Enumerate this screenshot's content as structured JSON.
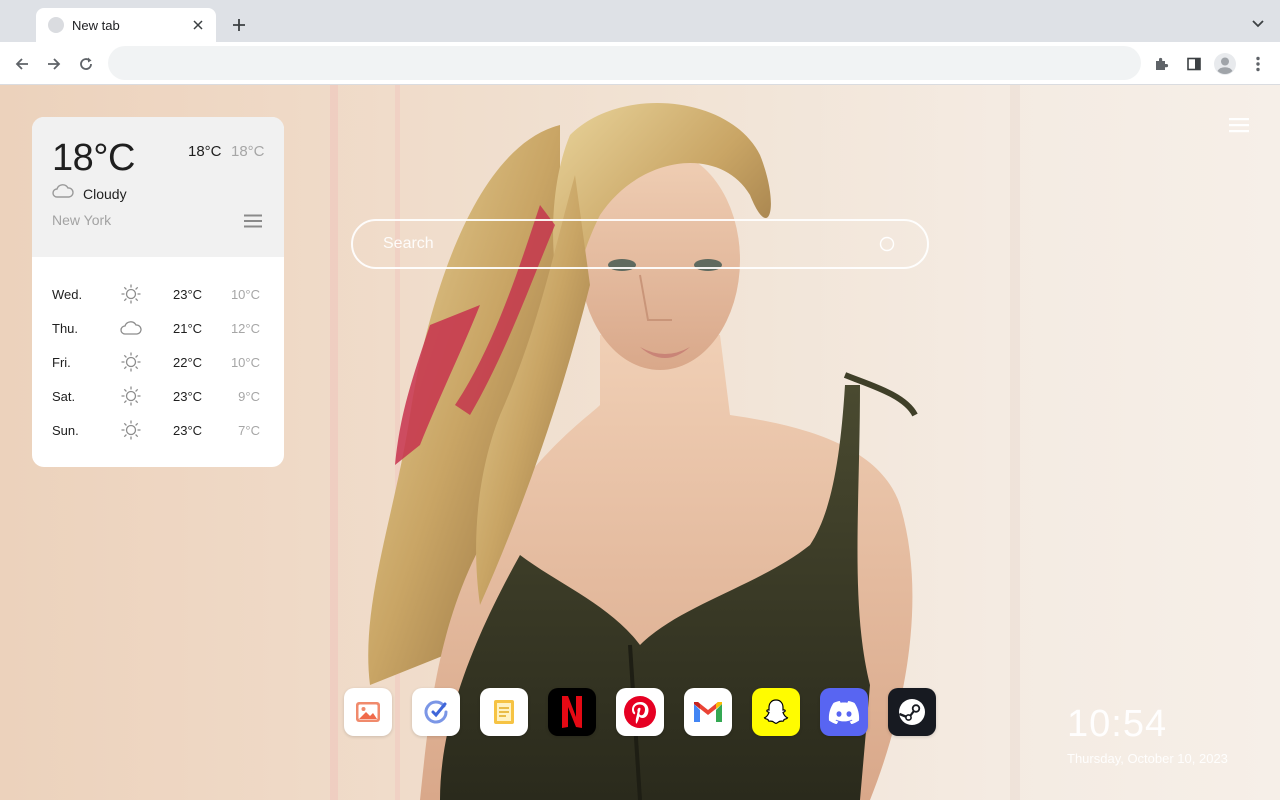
{
  "browser": {
    "tab": {
      "title": "New tab"
    },
    "omnibox": {
      "value": "",
      "placeholder": ""
    }
  },
  "weather": {
    "current_temp": "18°C",
    "high": "18°C",
    "low": "18°C",
    "condition": "Cloudy",
    "condition_icon": "cloud-icon",
    "city": "New York",
    "forecast": [
      {
        "day": "Wed.",
        "icon": "sun-icon",
        "high": "23°C",
        "low": "10°C"
      },
      {
        "day": "Thu.",
        "icon": "cloud-icon",
        "high": "21°C",
        "low": "12°C"
      },
      {
        "day": "Fri.",
        "icon": "sun-icon",
        "high": "22°C",
        "low": "10°C"
      },
      {
        "day": "Sat.",
        "icon": "sun-icon",
        "high": "23°C",
        "low": "9°C"
      },
      {
        "day": "Sun.",
        "icon": "sun-icon",
        "high": "23°C",
        "low": "7°C"
      }
    ]
  },
  "search": {
    "placeholder": "Search"
  },
  "dock": {
    "apps": [
      {
        "name": "gallery",
        "icon": "image-icon",
        "bg": "#ffffff"
      },
      {
        "name": "tasks",
        "icon": "check-circle-icon",
        "bg": "#ffffff"
      },
      {
        "name": "notes",
        "icon": "note-icon",
        "bg": "#ffffff"
      },
      {
        "name": "netflix",
        "icon": "netflix-icon",
        "bg": "#000000",
        "letter": "N"
      },
      {
        "name": "pinterest",
        "icon": "pinterest-icon",
        "bg": "#ffffff"
      },
      {
        "name": "gmail",
        "icon": "gmail-icon",
        "bg": "#ffffff"
      },
      {
        "name": "snapchat",
        "icon": "ghost-icon",
        "bg": "#fffc00"
      },
      {
        "name": "discord",
        "icon": "discord-icon",
        "bg": "#5865f2"
      },
      {
        "name": "steam",
        "icon": "steam-icon",
        "bg": "#171a21"
      }
    ]
  },
  "clock": {
    "time": "10:54",
    "date": "Thursday, October 10, 2023"
  },
  "colors": {
    "netflix_red": "#e50914",
    "pinterest_red": "#e60023",
    "gmail_red": "#ea4335",
    "discord": "#5865f2",
    "snapchat": "#fffc00"
  }
}
